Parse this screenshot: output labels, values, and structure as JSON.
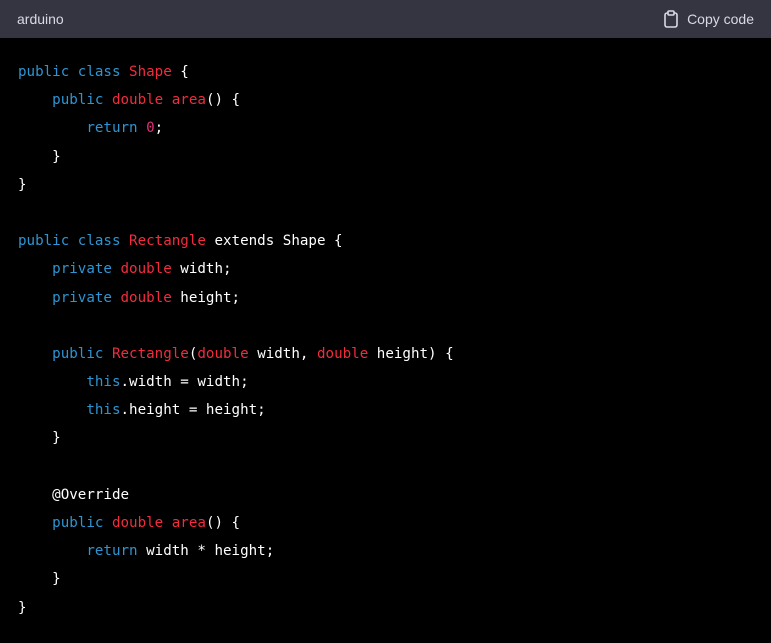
{
  "header": {
    "language": "arduino",
    "copy_label": "Copy code",
    "copy_icon": "clipboard-icon"
  },
  "colors": {
    "header_bg": "#343541",
    "code_bg": "#000000",
    "keyword": "#2e95d3",
    "type_or_name": "#f22c3d",
    "number": "#df3079",
    "text": "#ffffff"
  },
  "code": {
    "lines": [
      [
        {
          "t": "public class ",
          "c": "kw"
        },
        {
          "t": "Shape",
          "c": "name"
        },
        {
          "t": " {",
          "c": "punct"
        }
      ],
      [
        {
          "t": "    public ",
          "c": "kw"
        },
        {
          "t": "double ",
          "c": "type"
        },
        {
          "t": "area",
          "c": "name"
        },
        {
          "t": "() {",
          "c": "punct"
        }
      ],
      [
        {
          "t": "        return ",
          "c": "kw"
        },
        {
          "t": "0",
          "c": "num"
        },
        {
          "t": ";",
          "c": "punct"
        }
      ],
      [
        {
          "t": "    }",
          "c": "punct"
        }
      ],
      [
        {
          "t": "}",
          "c": "punct"
        }
      ],
      [],
      [
        {
          "t": "public class ",
          "c": "kw"
        },
        {
          "t": "Rectangle",
          "c": "name"
        },
        {
          "t": " extends Shape {",
          "c": "plain"
        }
      ],
      [
        {
          "t": "    private ",
          "c": "kw"
        },
        {
          "t": "double ",
          "c": "type"
        },
        {
          "t": "width;",
          "c": "plain"
        }
      ],
      [
        {
          "t": "    private ",
          "c": "kw"
        },
        {
          "t": "double ",
          "c": "type"
        },
        {
          "t": "height;",
          "c": "plain"
        }
      ],
      [],
      [
        {
          "t": "    public ",
          "c": "kw"
        },
        {
          "t": "Rectangle",
          "c": "name"
        },
        {
          "t": "(",
          "c": "punct"
        },
        {
          "t": "double ",
          "c": "type"
        },
        {
          "t": "width, ",
          "c": "plain"
        },
        {
          "t": "double ",
          "c": "type"
        },
        {
          "t": "height) {",
          "c": "plain"
        }
      ],
      [
        {
          "t": "        this",
          "c": "kw"
        },
        {
          "t": ".width = width;",
          "c": "plain"
        }
      ],
      [
        {
          "t": "        this",
          "c": "kw"
        },
        {
          "t": ".height = height;",
          "c": "plain"
        }
      ],
      [
        {
          "t": "    }",
          "c": "punct"
        }
      ],
      [],
      [
        {
          "t": "    @Override",
          "c": "ann"
        }
      ],
      [
        {
          "t": "    public ",
          "c": "kw"
        },
        {
          "t": "double ",
          "c": "type"
        },
        {
          "t": "area",
          "c": "name"
        },
        {
          "t": "() {",
          "c": "punct"
        }
      ],
      [
        {
          "t": "        return ",
          "c": "kw"
        },
        {
          "t": "width * height;",
          "c": "plain"
        }
      ],
      [
        {
          "t": "    }",
          "c": "punct"
        }
      ],
      [
        {
          "t": "}",
          "c": "punct"
        }
      ]
    ]
  }
}
